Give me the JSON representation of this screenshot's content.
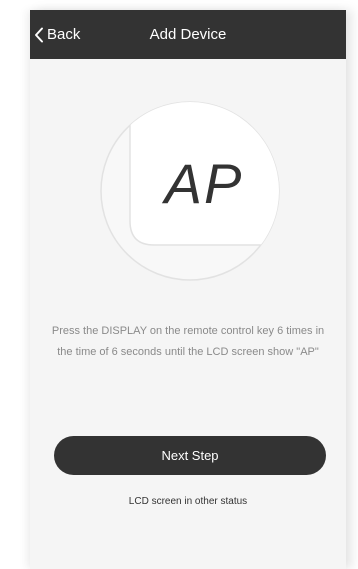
{
  "navbar": {
    "back_label": "Back",
    "title": "Add Device"
  },
  "illustration": {
    "lcd_text": "AP"
  },
  "instruction": {
    "line1": "Press the DISPLAY on the remote control key 6 times in",
    "line2": "the time of 6 seconds until the LCD screen show \"AP\""
  },
  "actions": {
    "next_label": "Next Step",
    "other_status_label": "LCD screen in other status"
  },
  "colors": {
    "navbar_bg": "#333333",
    "page_bg": "#f5f5f5",
    "button_bg": "#333333",
    "instruction_text": "#8a8a8a"
  }
}
